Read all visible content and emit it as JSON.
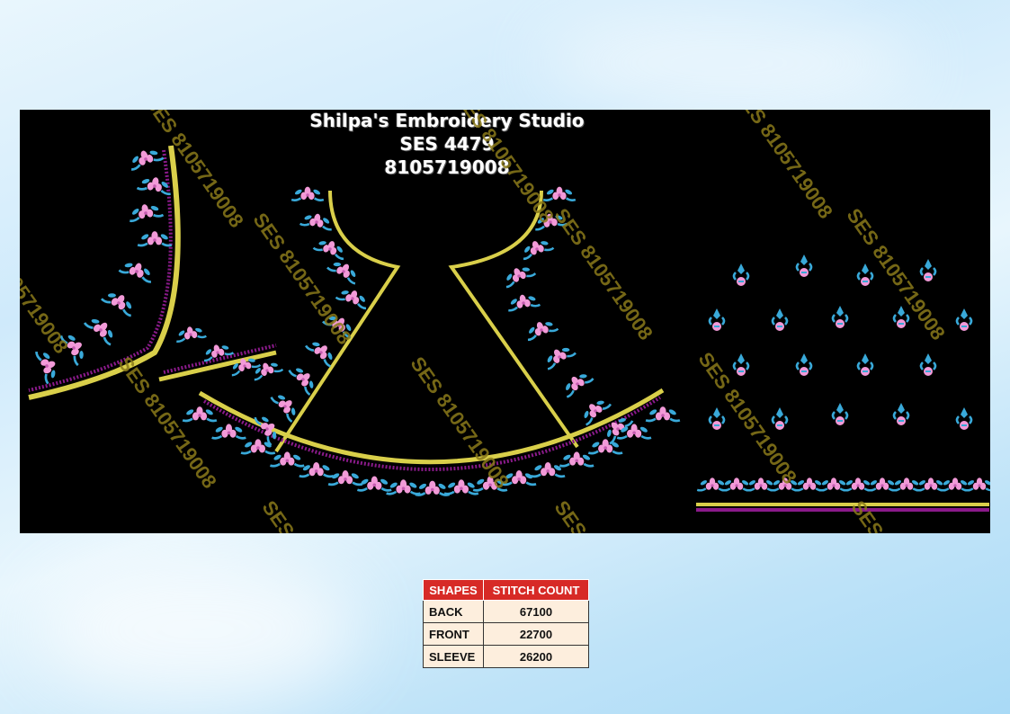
{
  "title": {
    "studio_name": "Shilpa's Embroidery Studio",
    "design_code": "SES 4479",
    "phone": "8105719008"
  },
  "watermark": {
    "text": "SES 8105719008",
    "color": "#8a7a1a"
  },
  "colors": {
    "panel_bg": "#000000",
    "thread_pink": "#f29ad8",
    "thread_blue": "#39a9d9",
    "thread_gold": "#d9cf4a",
    "thread_purple": "#8a1a8a",
    "table_header_bg": "#d72a26",
    "table_cell_bg": "#fdeedd"
  },
  "stitch_table": {
    "headers": [
      "SHAPES",
      "STITCH COUNT"
    ],
    "rows": [
      {
        "shape": "BACK",
        "count": "67100"
      },
      {
        "shape": "FRONT",
        "count": "22700"
      },
      {
        "shape": "SLEEVE",
        "count": "26200"
      }
    ]
  }
}
